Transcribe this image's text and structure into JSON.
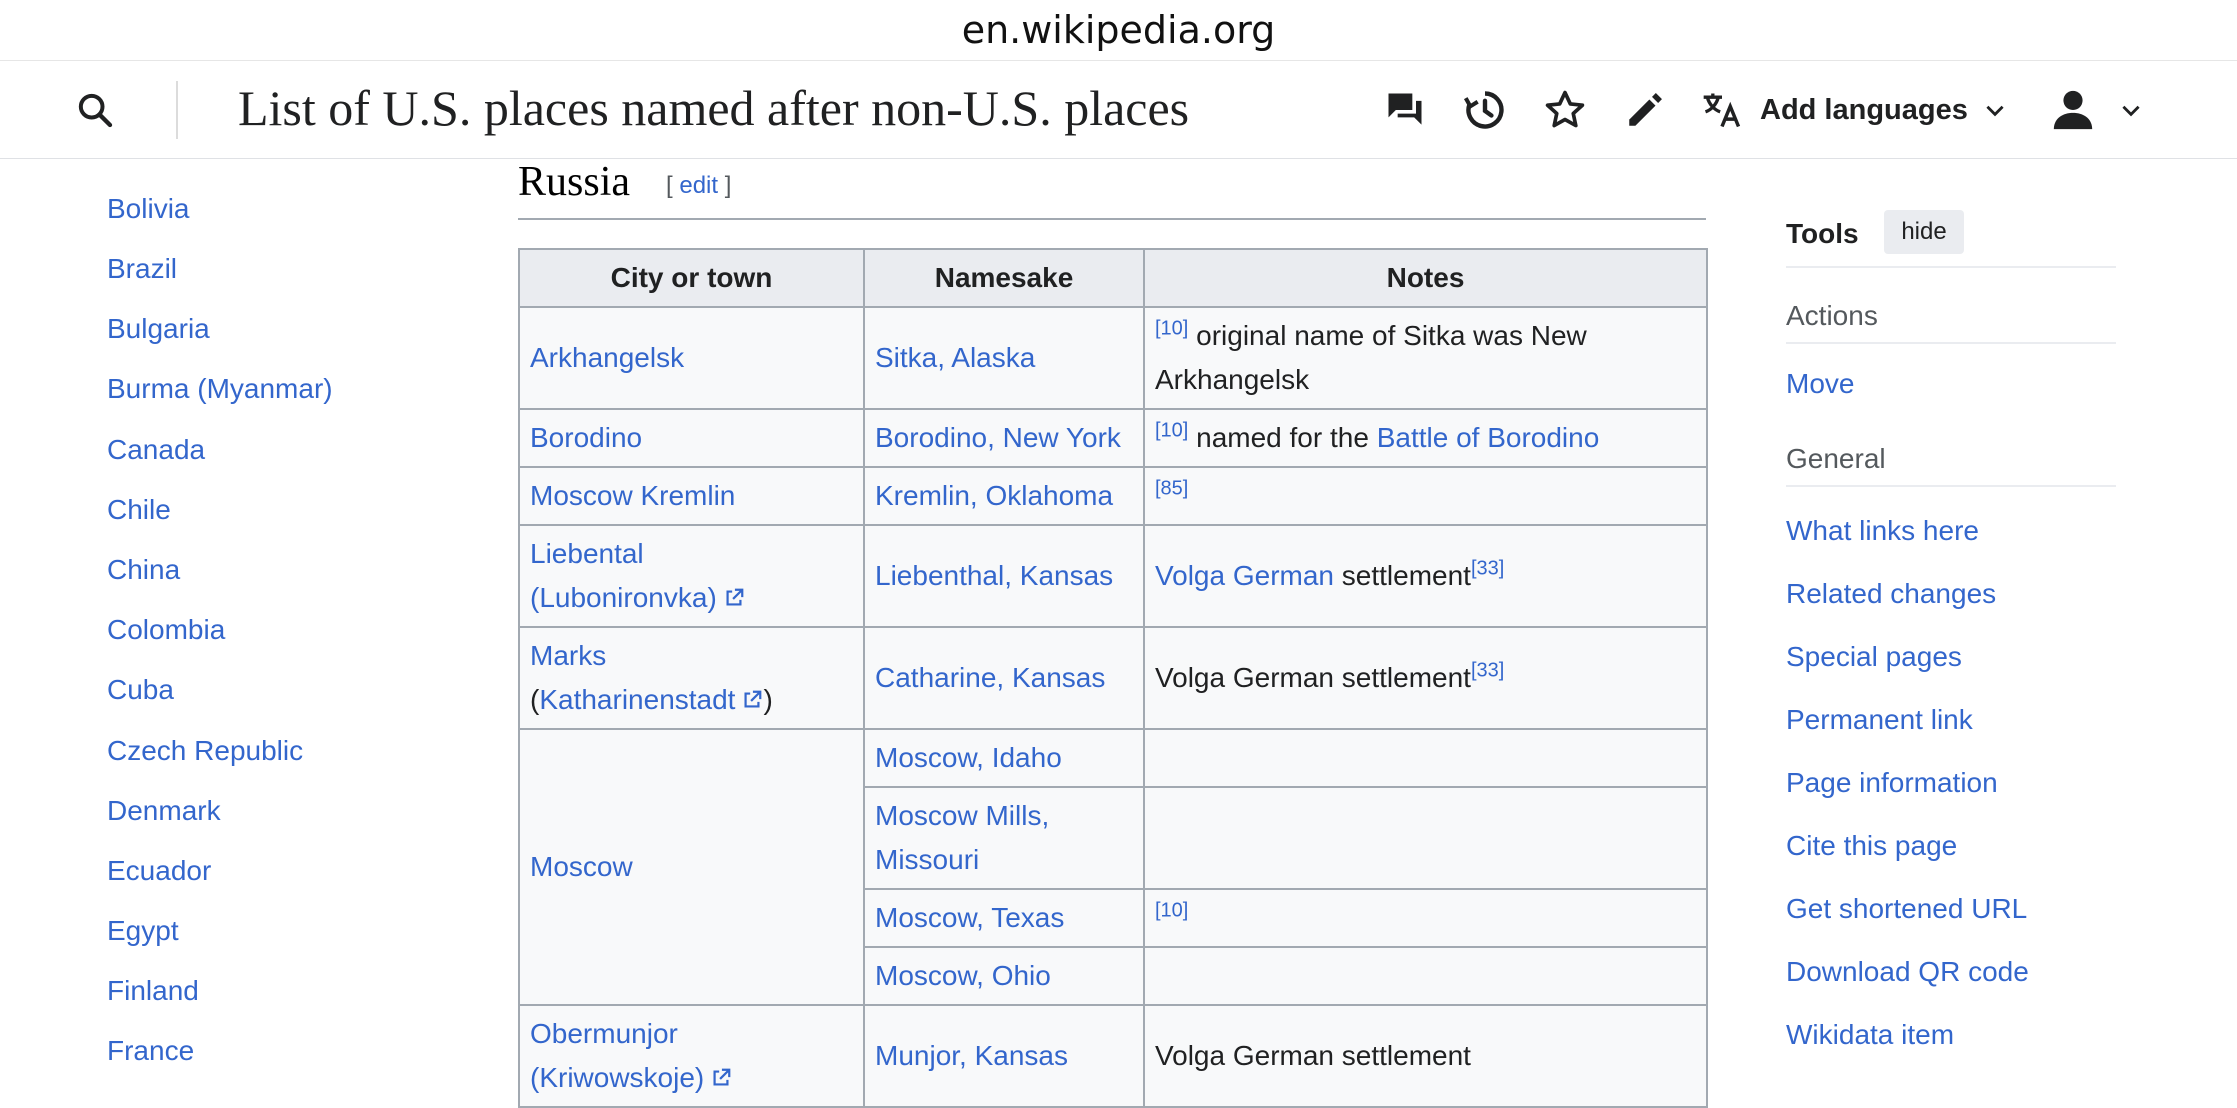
{
  "browser": {
    "url": "en.wikipedia.org"
  },
  "header": {
    "title": "List of U.S. places named after non-U.S. places",
    "add_languages": "Add languages",
    "icons": [
      "search-icon",
      "talk-icon",
      "history-icon",
      "watch-star-icon",
      "edit-pencil-icon",
      "language-icon",
      "chevron-down-icon",
      "user-icon"
    ]
  },
  "toc": {
    "items": [
      "Bolivia",
      "Brazil",
      "Bulgaria",
      "Burma (Myanmar)",
      "Canada",
      "Chile",
      "China",
      "Colombia",
      "Cuba",
      "Czech Republic",
      "Denmark",
      "Ecuador",
      "Egypt",
      "Finland",
      "France"
    ]
  },
  "section": {
    "heading": "Russia",
    "edit_open": "[",
    "edit_label": "edit",
    "edit_close": "]"
  },
  "table": {
    "headers": [
      "City or town",
      "Namesake",
      "Notes"
    ],
    "rows": {
      "arkhangelsk": {
        "city": "Arkhangelsk",
        "namesake": "Sitka, Alaska",
        "ref": "[10]",
        "note": " original name of Sitka was New Arkhangelsk"
      },
      "borodino": {
        "city": "Borodino",
        "namesake": "Borodino, New York",
        "ref": "[10]",
        "note_pre": " named for the ",
        "note_link": "Battle of Borodino"
      },
      "kremlin": {
        "city": "Moscow Kremlin",
        "namesake": "Kremlin, Oklahoma",
        "ref": "[85]"
      },
      "liebental": {
        "city_line1": "Liebental",
        "city_line2": "(Luboniron­vka)",
        "namesake": "Liebenthal, Kansas",
        "note_link": "Volga German",
        "note_text": " settlement",
        "ref": "[33]"
      },
      "marks": {
        "city_line1": "Marks",
        "city_open": "(",
        "city_link": "Katharinenstadt",
        "city_close": ")",
        "namesake": "Catharine, Kansas",
        "note_text": "Volga German settlement",
        "ref": "[33]"
      },
      "moscow": {
        "city": "Moscow",
        "namesakes": [
          "Moscow, Idaho",
          "Moscow Mills, Missouri",
          "Moscow, Texas",
          "Moscow, Ohio"
        ],
        "texas_ref": "[10]"
      },
      "obermunjor": {
        "city_line1": "Obermunjor",
        "city_line2": "(Kriwowskoje)",
        "namesake": "Munjor, Kansas",
        "note_text": "Volga German settlement"
      }
    }
  },
  "tools": {
    "title": "Tools",
    "hide": "hide",
    "actions_label": "Actions",
    "move": "Move",
    "general_label": "General",
    "links": [
      "What links here",
      "Related changes",
      "Special pages",
      "Permanent link",
      "Page information",
      "Cite this page",
      "Get shortened URL",
      "Download QR code",
      "Wikidata item"
    ]
  }
}
